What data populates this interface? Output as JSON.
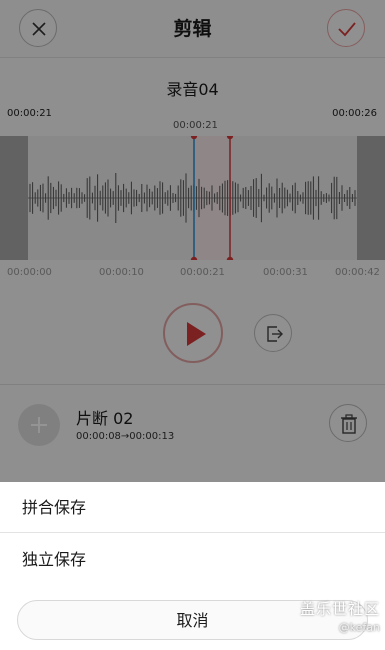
{
  "header": {
    "title": "剪辑"
  },
  "recording": {
    "title": "录音04",
    "start_time": "00:00:21",
    "end_time": "00:00:26",
    "cursor_time": "00:00:21"
  },
  "timeline": {
    "ticks": [
      "00:00:00",
      "00:00:10",
      "00:00:21",
      "00:00:31",
      "00:00:42"
    ]
  },
  "clip": {
    "name": "片断 02",
    "range": "00:00:08→00:00:13"
  },
  "sheet": {
    "option_merge": "拼合保存",
    "option_separate": "独立保存",
    "cancel": "取消"
  },
  "watermark": {
    "brand": "盖乐世社区",
    "user": "@kefan"
  },
  "colors": {
    "accent_red": "#d43a3a",
    "accent_blue": "#2b8fd6",
    "overlay": "rgba(0,0,0,0.42)"
  },
  "icons": {
    "close": "close-icon",
    "confirm": "check-icon",
    "play": "play-icon",
    "export": "export-icon",
    "add": "plus-icon",
    "delete": "trash-icon"
  }
}
